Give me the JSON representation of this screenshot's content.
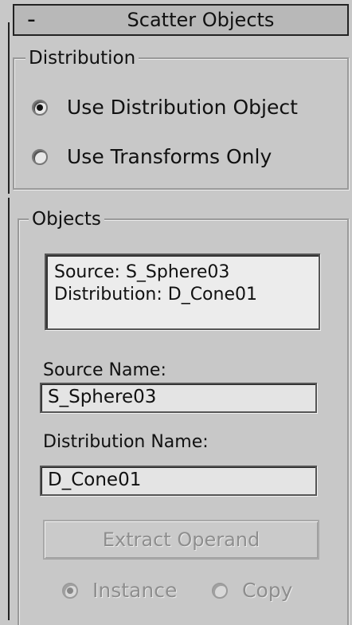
{
  "rollout": {
    "toggle": "-",
    "title": "Scatter Objects"
  },
  "distribution": {
    "group_label": "Distribution",
    "options": [
      {
        "label": "Use Distribution Object",
        "selected": true
      },
      {
        "label": "Use Transforms Only",
        "selected": false
      }
    ]
  },
  "objects": {
    "group_label": "Objects",
    "list": [
      "Source: S_Sphere03",
      "Distribution: D_Cone01"
    ],
    "source_name_label": "Source Name:",
    "source_name_value": "S_Sphere03",
    "distribution_name_label": "Distribution Name:",
    "distribution_name_value": "D_Cone01",
    "extract_button": "Extract Operand",
    "copy_mode": [
      {
        "label": "Instance",
        "selected": true,
        "enabled": false
      },
      {
        "label": "Copy",
        "selected": false,
        "enabled": false
      }
    ]
  }
}
